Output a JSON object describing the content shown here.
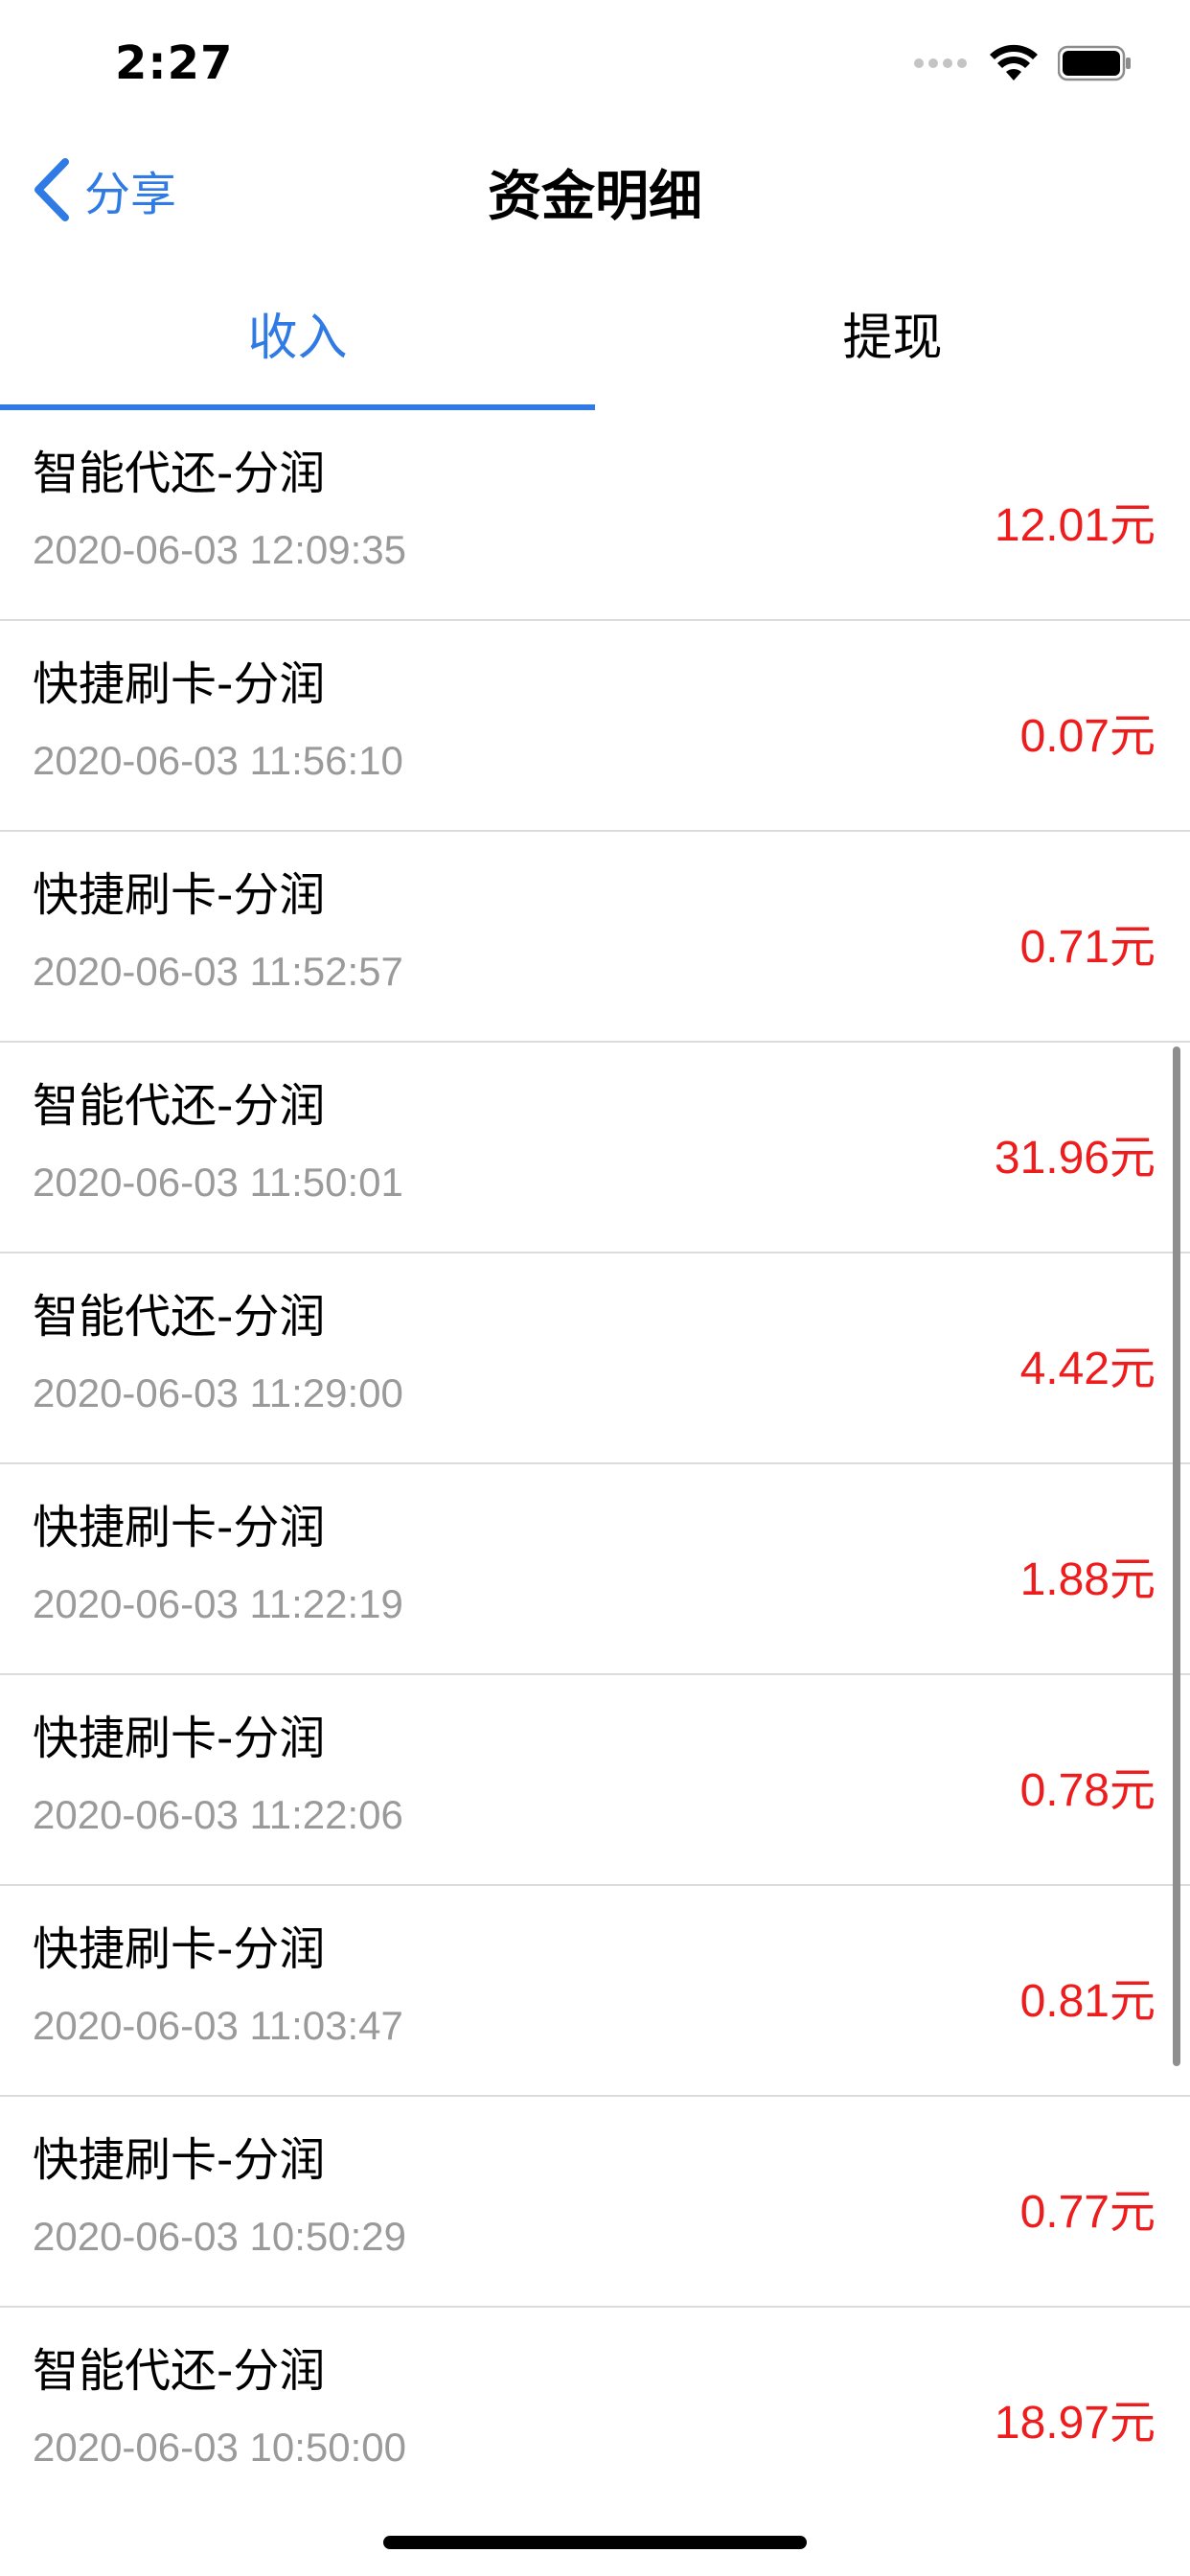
{
  "status_bar": {
    "time": "2:27",
    "icons": [
      "signal-dots-icon",
      "wifi-icon",
      "battery-icon"
    ]
  },
  "nav": {
    "back_label": "分享",
    "title": "资金明细"
  },
  "tabs": [
    {
      "label": "收入",
      "active": true
    },
    {
      "label": "提现",
      "active": false
    }
  ],
  "colors": {
    "accent": "#2f7ae5",
    "amount": "#ee1c1c",
    "timestamp": "#9a9a9a",
    "divider": "#dcdcdc"
  },
  "records": [
    {
      "title": "智能代还-分润",
      "time": "2020-06-03 12:09:35",
      "amount": "12.01元"
    },
    {
      "title": "快捷刷卡-分润",
      "time": "2020-06-03 11:56:10",
      "amount": "0.07元"
    },
    {
      "title": "快捷刷卡-分润",
      "time": "2020-06-03 11:52:57",
      "amount": "0.71元"
    },
    {
      "title": "智能代还-分润",
      "time": "2020-06-03 11:50:01",
      "amount": "31.96元"
    },
    {
      "title": "智能代还-分润",
      "time": "2020-06-03 11:29:00",
      "amount": "4.42元"
    },
    {
      "title": "快捷刷卡-分润",
      "time": "2020-06-03 11:22:19",
      "amount": "1.88元"
    },
    {
      "title": "快捷刷卡-分润",
      "time": "2020-06-03 11:22:06",
      "amount": "0.78元"
    },
    {
      "title": "快捷刷卡-分润",
      "time": "2020-06-03 11:03:47",
      "amount": "0.81元"
    },
    {
      "title": "快捷刷卡-分润",
      "time": "2020-06-03 10:50:29",
      "amount": "0.77元"
    },
    {
      "title": "智能代还-分润",
      "time": "2020-06-03 10:50:00",
      "amount": "18.97元"
    }
  ]
}
